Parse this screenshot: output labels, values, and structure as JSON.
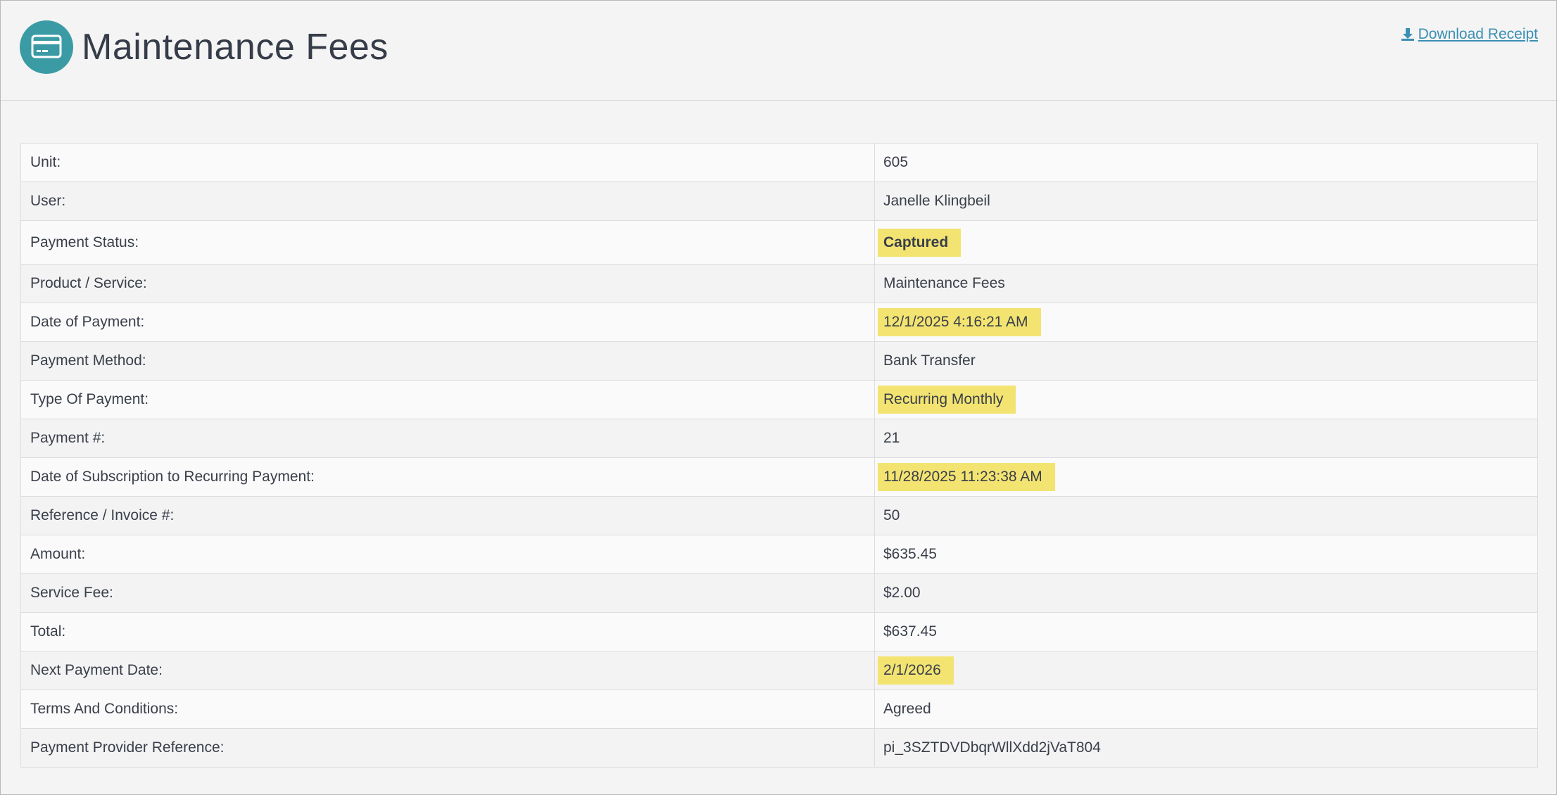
{
  "header": {
    "title": "Maintenance Fees",
    "icon": "credit-card-icon",
    "download_label": "Download Receipt",
    "download_icon": "download-icon",
    "accent_color": "#3b9ba4",
    "link_color": "#3a8fb4"
  },
  "details": {
    "highlight_color": "#f3e472",
    "rows": [
      {
        "label": "Unit:",
        "value": "605"
      },
      {
        "label": "User:",
        "value": "Janelle Klingbeil"
      },
      {
        "label": "Payment Status:",
        "value": "Captured"
      },
      {
        "label": "Product / Service:",
        "value": "Maintenance Fees"
      },
      {
        "label": "Date of Payment:",
        "value": "12/1/2025 4:16:21 AM"
      },
      {
        "label": "Payment Method:",
        "value": "Bank Transfer"
      },
      {
        "label": "Type Of Payment:",
        "value": "Recurring Monthly"
      },
      {
        "label": "Payment #:",
        "value": "21"
      },
      {
        "label": "Date of Subscription to Recurring Payment:",
        "value": "11/28/2025 11:23:38 AM"
      },
      {
        "label": "Reference / Invoice #:",
        "value": "50"
      },
      {
        "label": "Amount:",
        "value": "$635.45"
      },
      {
        "label": "Service Fee:",
        "value": "$2.00"
      },
      {
        "label": "Total:",
        "value": "$637.45"
      },
      {
        "label": "Next Payment Date:",
        "value": "2/1/2026"
      },
      {
        "label": "Terms And Conditions:",
        "value": "Agreed"
      },
      {
        "label": "Payment Provider Reference:",
        "value": "pi_3SZTDVDbqrWllXdd2jVaT804"
      }
    ]
  }
}
